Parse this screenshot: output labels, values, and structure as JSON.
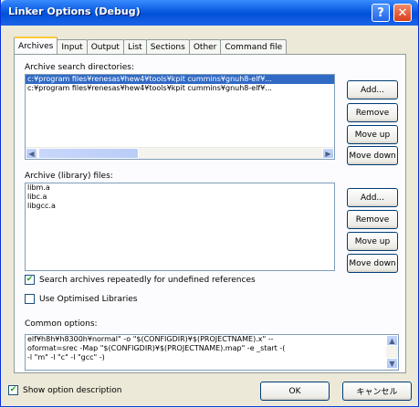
{
  "window": {
    "title": "Linker Options (Debug)"
  },
  "titlebar": {
    "help_glyph": "?",
    "close_glyph": "✕"
  },
  "tabs": [
    {
      "label": "Archives",
      "active": true
    },
    {
      "label": "Input",
      "active": false
    },
    {
      "label": "Output",
      "active": false
    },
    {
      "label": "List",
      "active": false
    },
    {
      "label": "Sections",
      "active": false
    },
    {
      "label": "Other",
      "active": false
    },
    {
      "label": "Command file",
      "active": false
    }
  ],
  "archive_dirs": {
    "label": "Archive search directories:",
    "items": [
      "c:¥program files¥renesas¥hew4¥tools¥kpit cummins¥gnuh8-elf¥...",
      "c:¥program files¥renesas¥hew4¥tools¥kpit cummins¥gnuh8-elf¥..."
    ],
    "buttons": {
      "add": "Add...",
      "remove": "Remove",
      "move_up": "Move up",
      "move_down": "Move down"
    }
  },
  "archive_files": {
    "label": "Archive (library) files:",
    "items": [
      "libm.a",
      "libc.a",
      "libgcc.a"
    ],
    "buttons": {
      "add": "Add...",
      "remove": "Remove",
      "move_up": "Move up",
      "move_down": "Move down"
    }
  },
  "options": {
    "search_repeatedly": {
      "label": "Search archives repeatedly for undefined references",
      "checked": true
    },
    "use_optimised": {
      "label": "Use Optimised Libraries",
      "checked": false
    }
  },
  "common_options": {
    "label": "Common options:",
    "lines": [
      "elf¥h8h¥h8300h¥normal\" -o \"$(CONFIGDIR)¥$(PROJECTNAME).x\" --",
      "oformat=srec -Map \"$(CONFIGDIR)¥$(PROJECTNAME).map\" -e _start -(",
      "-l \"m\" -l \"c\" -l \"gcc\" -)"
    ]
  },
  "footer": {
    "show_description": {
      "label": "Show option description",
      "checked": true
    },
    "ok_label": "OK",
    "cancel_label": "キャンセル"
  },
  "scroll_glyphs": {
    "left": "◀",
    "right": "▶",
    "up": "▲",
    "down": "▼"
  },
  "check_glyph": "✔"
}
